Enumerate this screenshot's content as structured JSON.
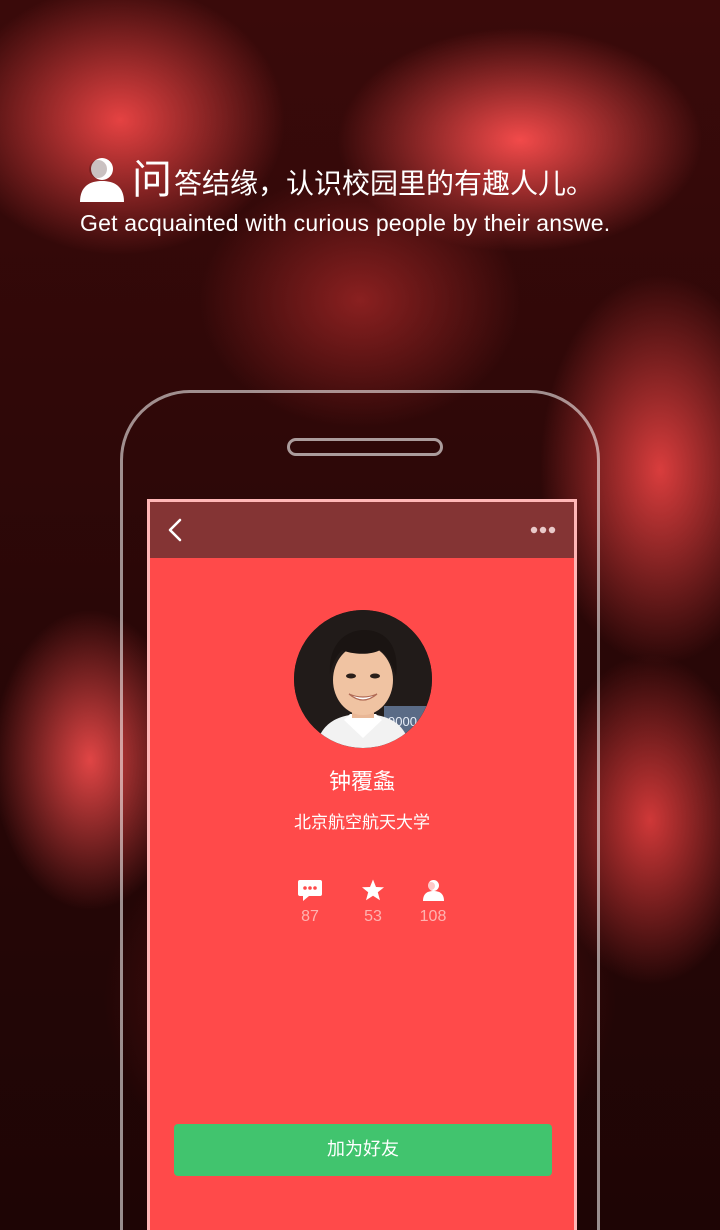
{
  "headline": {
    "first_char": "问",
    "rest": "答结缘，认识校园里的有趣人儿。",
    "subtitle": "Get acquainted with curious people by their answe.",
    "icon": "people-icon"
  },
  "screen": {
    "topbar": {
      "back_icon": "chevron-left-icon",
      "more_icon": "more-dots-icon",
      "color": "#843434"
    },
    "profile": {
      "name": "钟覆螽",
      "school": "北京航空航天大学",
      "avatar_badge": "9000"
    },
    "stats": [
      {
        "icon": "comment-icon",
        "value": "87"
      },
      {
        "icon": "star-icon",
        "value": "53"
      },
      {
        "icon": "followers-icon",
        "value": "108"
      }
    ],
    "add_friend_label": "加为好友",
    "colors": {
      "screen_bg": "#ff4a4a",
      "button": "#41c46e"
    }
  }
}
